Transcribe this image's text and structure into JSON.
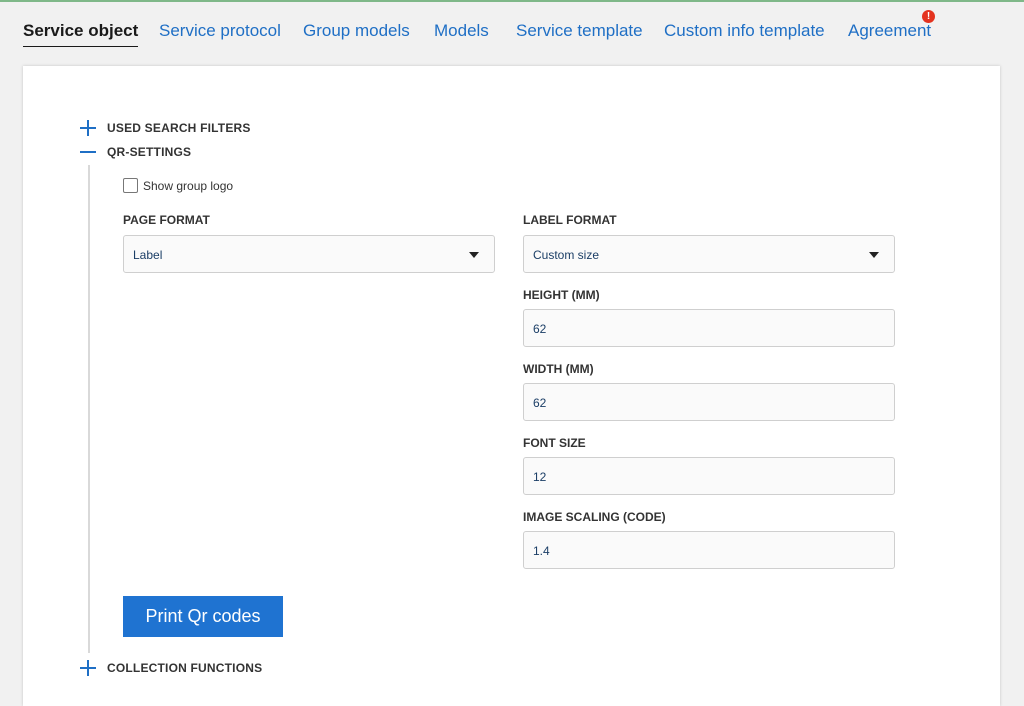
{
  "tabs": [
    {
      "label": "Service object"
    },
    {
      "label": "Service protocol"
    },
    {
      "label": "Group models"
    },
    {
      "label": "Models"
    },
    {
      "label": "Service template"
    },
    {
      "label": "Custom info template"
    },
    {
      "label": "Agreement",
      "badge": "!"
    }
  ],
  "sections": {
    "used_search_filters": {
      "title": "USED SEARCH FILTERS"
    },
    "qr_settings": {
      "title": "QR-SETTINGS"
    },
    "collection_functions": {
      "title": "COLLECTION FUNCTIONS"
    }
  },
  "qr": {
    "show_group_logo_label": "Show group logo",
    "show_group_logo_checked": false,
    "page_format": {
      "label": "PAGE FORMAT",
      "value": "Label"
    },
    "label_format": {
      "label": "LABEL FORMAT",
      "value": "Custom size"
    },
    "height": {
      "label": "HEIGHT (MM)",
      "value": "62"
    },
    "width": {
      "label": "WIDTH (MM)",
      "value": "62"
    },
    "font_size": {
      "label": "FONT SIZE",
      "value": "12"
    },
    "image_scaling": {
      "label": "IMAGE SCALING (CODE)",
      "value": "1.4"
    },
    "print_button": "Print Qr codes"
  },
  "colors": {
    "accent": "#1f6fc5",
    "button": "#1f73d1",
    "badge": "#e4331f",
    "top_line": "#7fb889"
  }
}
